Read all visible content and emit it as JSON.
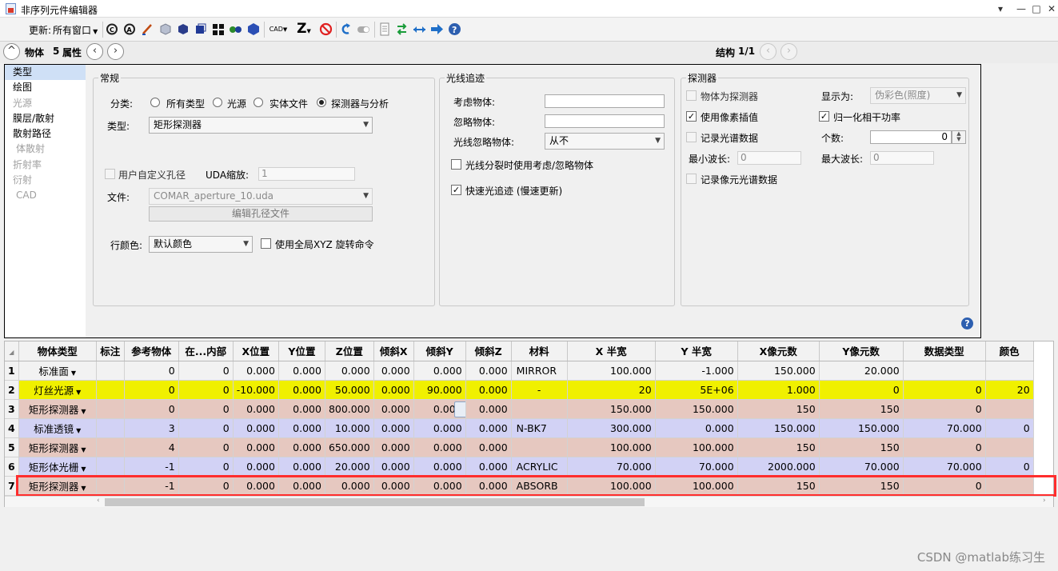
{
  "window": {
    "title": "非序列元件编辑器",
    "buttons": [
      "▾",
      "—",
      "□",
      "✕"
    ]
  },
  "toolbar": {
    "update_label": "更新:",
    "update_value": "所有窗口",
    "cad_label": "CAD",
    "z_label": "Z"
  },
  "nav": {
    "object_label": "物体",
    "object_number": "5",
    "properties_label": "属性",
    "structure_label": "结构",
    "structure_value": "1/1"
  },
  "sidebar": {
    "items": [
      {
        "label": "类型",
        "state": "selected"
      },
      {
        "label": "绘图",
        "state": "normal"
      },
      {
        "label": "光源",
        "state": "disabled"
      },
      {
        "label": "膜层/散射",
        "state": "normal"
      },
      {
        "label": "散射路径",
        "state": "normal"
      },
      {
        "label": "体散射",
        "state": "disabled"
      },
      {
        "label": "折射率",
        "state": "disabled"
      },
      {
        "label": "衍射",
        "state": "disabled"
      },
      {
        "label": "CAD",
        "state": "disabled"
      }
    ]
  },
  "general": {
    "group_title": "常规",
    "category_label": "分类:",
    "radio_all": "所有类型",
    "radio_source": "光源",
    "radio_solid": "实体文件",
    "radio_detector": "探测器与分析",
    "type_label": "类型:",
    "type_value": "矩形探测器",
    "user_aperture_label": "用户自定义孔径",
    "uda_scale_label": "UDA缩放:",
    "uda_scale_value": "1",
    "file_label": "文件:",
    "file_value": "COMAR_aperture_10.uda",
    "edit_aperture_button": "编辑孔径文件",
    "row_color_label": "行颜色:",
    "row_color_value": "默认颜色",
    "global_xyz_label": "使用全局XYZ 旋转命令"
  },
  "raytrace": {
    "group_title": "光线追迹",
    "consider_label": "考虑物体:",
    "consider_value": "",
    "ignore_label": "忽略物体:",
    "ignore_value": "",
    "ray_ignore_label": "光线忽略物体:",
    "ray_ignore_value": "从不",
    "split_label": "光线分裂时使用考虑/忽略物体",
    "fast_trace_label": "快速光追迹 (慢速更新)"
  },
  "detector": {
    "group_title": "探测器",
    "obj_is_detector": "物体为探测器",
    "display_as_label": "显示为:",
    "display_as_value": "伪彩色(照度)",
    "pixel_interp": "使用像素插值",
    "normalize_coherent": "归一化相干功率",
    "record_spectral": "记录光谱数据",
    "count_label": "个数:",
    "count_value": "0",
    "min_wave_label": "最小波长:",
    "min_wave_value": "0",
    "max_wave_label": "最大波长:",
    "max_wave_value": "0",
    "record_pixel_spectral": "记录像元光谱数据"
  },
  "table": {
    "columns": [
      "",
      "物体类型",
      "标注",
      "参考物体",
      "在...内部",
      "X位置",
      "Y位置",
      "Z位置",
      "倾斜X",
      "倾斜Y",
      "倾斜Z",
      "材料",
      "X 半宽",
      "Y 半宽",
      "X像元数",
      "Y像元数",
      "数据类型",
      "颜色"
    ],
    "rows": [
      {
        "num": "1",
        "type": "标准面",
        "note": "",
        "ref": "0",
        "inside": "0",
        "x": "0.000",
        "y": "0.000",
        "z": "0.000",
        "tx": "0.000",
        "ty": "0.000",
        "tz": "0.000",
        "mat": "MIRROR",
        "p1": "100.000",
        "p2": "-1.000",
        "p3": "150.000",
        "p4": "20.000",
        "p5": "",
        "p6": "",
        "color": "#f2f2f2"
      },
      {
        "num": "2",
        "type": "灯丝光源",
        "note": "",
        "ref": "0",
        "inside": "0",
        "x": "-10.000",
        "y": "0.000",
        "z": "50.000",
        "tx": "0.000",
        "ty": "90.000",
        "tz": "0.000",
        "mat": "-",
        "p1": "20",
        "p2": "5E+06",
        "p3": "1.000",
        "p4": "0",
        "p5": "0",
        "p6": "20",
        "color": "#f0f000"
      },
      {
        "num": "3",
        "type": "矩形探测器",
        "note": "",
        "ref": "0",
        "inside": "0",
        "x": "0.000",
        "y": "0.000",
        "z": "800.000",
        "tx": "0.000",
        "ty": "0.000",
        "tz": "0.000",
        "mat": "",
        "p1": "150.000",
        "p2": "150.000",
        "p3": "150",
        "p4": "150",
        "p5": "0",
        "p6": "",
        "color": "#e6c8c0"
      },
      {
        "num": "4",
        "type": "标准透镜",
        "note": "",
        "ref": "3",
        "inside": "0",
        "x": "0.000",
        "y": "0.000",
        "z": "10.000",
        "tx": "0.000",
        "ty": "0.000",
        "tz": "0.000",
        "mat": "N-BK7",
        "p1": "300.000",
        "p2": "0.000",
        "p3": "150.000",
        "p4": "150.000",
        "p5": "70.000",
        "p6": "0",
        "color": "#d2d2f5"
      },
      {
        "num": "5",
        "type": "矩形探测器",
        "note": "",
        "ref": "4",
        "inside": "0",
        "x": "0.000",
        "y": "0.000",
        "z": "650.000",
        "tx": "0.000",
        "ty": "0.000",
        "tz": "0.000",
        "mat": "",
        "p1": "100.000",
        "p2": "100.000",
        "p3": "150",
        "p4": "150",
        "p5": "0",
        "p6": "",
        "color": "#e6c8c0"
      },
      {
        "num": "6",
        "type": "矩形体光栅",
        "note": "",
        "ref": "-1",
        "inside": "0",
        "x": "0.000",
        "y": "0.000",
        "z": "20.000",
        "tx": "0.000",
        "ty": "0.000",
        "tz": "0.000",
        "mat": "ACRYLIC",
        "p1": "70.000",
        "p2": "70.000",
        "p3": "2000.000",
        "p4": "70.000",
        "p5": "70.000",
        "p6": "0",
        "color": "#d2d2f5"
      },
      {
        "num": "7",
        "type": "矩形探测器",
        "note": "",
        "ref": "-1",
        "inside": "0",
        "x": "0.000",
        "y": "0.000",
        "z": "0.000",
        "tx": "0.000",
        "ty": "0.000",
        "tz": "0.000",
        "mat": "ABSORB",
        "p1": "100.000",
        "p2": "100.000",
        "p3": "150",
        "p4": "150",
        "p5": "0",
        "p6": "",
        "color": "#e6c8c0"
      }
    ]
  },
  "watermark": "CSDN @matlab练习生"
}
